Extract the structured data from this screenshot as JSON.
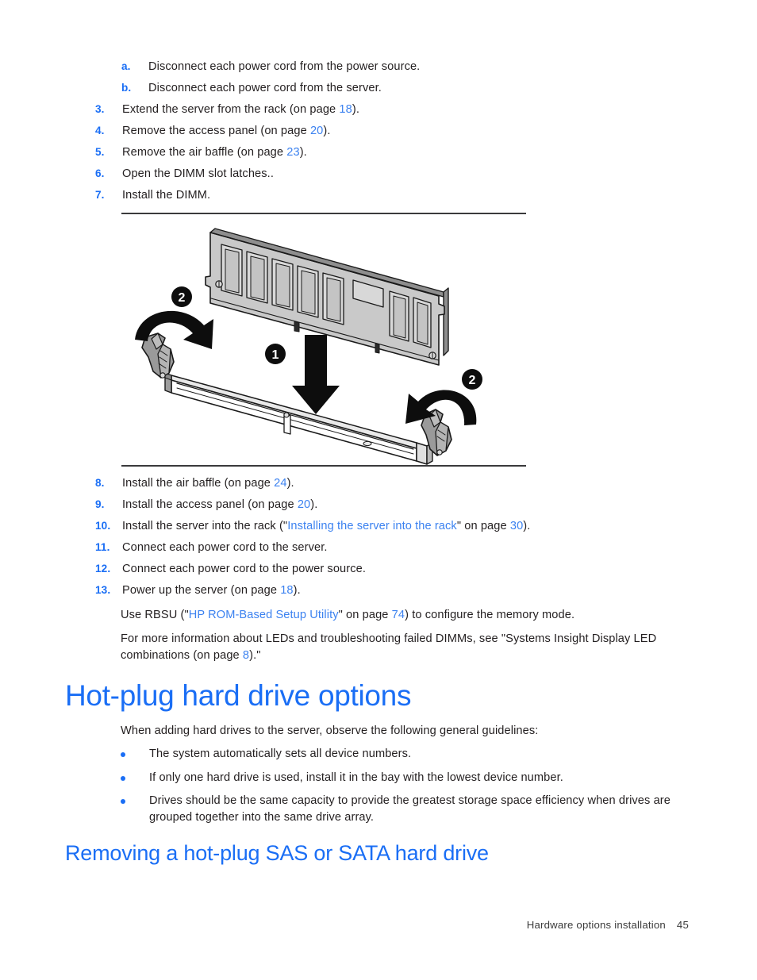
{
  "document": {
    "footer": {
      "chapter": "Hardware options installation",
      "page_number": "45"
    }
  },
  "steps_upper": [
    {
      "marker": "a.",
      "text_before": "Disconnect each power cord from the power source.",
      "text_after": ""
    },
    {
      "marker": "b.",
      "text_before": "Disconnect each power cord from the server.",
      "text_after": ""
    },
    {
      "marker": "3.",
      "text_before": "Extend the server from the rack (on page ",
      "page": "18",
      "text_after": ")."
    },
    {
      "marker": "4.",
      "text_before": "Remove the access panel (on page ",
      "page": "20",
      "text_after": ")."
    },
    {
      "marker": "5.",
      "text_before": "Remove the air baffle (on page ",
      "page": "23",
      "text_after": ")."
    },
    {
      "marker": "6.",
      "text_before": "Open the DIMM slot latches..",
      "text_after": ""
    },
    {
      "marker": "7.",
      "text_before": "Install the DIMM.",
      "text_after": ""
    }
  ],
  "figure": {
    "caption": "",
    "callouts": [
      {
        "id": "1",
        "label": "1",
        "meaning": "insert-dimm-downward"
      },
      {
        "id": "2a",
        "label": "2",
        "meaning": "close-left-latch"
      },
      {
        "id": "2b",
        "label": "2",
        "meaning": "close-right-latch"
      }
    ],
    "alt": "DIMM module being pressed down into a memory slot while both slot latches rotate closed"
  },
  "steps_lower": [
    {
      "marker": "8.",
      "text_before": "Install the air baffle (on page ",
      "page": "24",
      "text_after": ")."
    },
    {
      "marker": "9.",
      "text_before": "Install the access panel (on page ",
      "page": "20",
      "text_after": ")."
    },
    {
      "marker": "10.",
      "text_before": "Install the server into the rack (\"",
      "link": "Installing the server into the rack",
      "text_mid": "\" on page ",
      "page": "30",
      "text_after": ")."
    },
    {
      "marker": "11.",
      "text_before": "Connect each power cord to the server.",
      "text_after": ""
    },
    {
      "marker": "12.",
      "text_before": "Connect each power cord to the power source.",
      "text_after": ""
    },
    {
      "marker": "13.",
      "text_before": "Power up the server (on page ",
      "page": "18",
      "text_after": ")."
    }
  ],
  "paragraphs": {
    "rbsu_before": "Use RBSU (\"",
    "rbsu_link": "HP ROM-Based Setup Utility",
    "rbsu_mid": "\" on page ",
    "rbsu_page": "74",
    "rbsu_after": ") to configure the memory mode.",
    "leds_before": "For more information about LEDs and troubleshooting failed DIMMs, see \"Systems Insight Display LED combinations (on page ",
    "leds_page": "8",
    "leds_after": ")."
  },
  "section_hotplug": {
    "heading": "Hot-plug hard drive options",
    "intro": "When adding hard drives to the server, observe the following general guidelines:",
    "bullets": [
      "The system automatically sets all device numbers.",
      "If only one hard drive is used, install it in the bay with the lowest device number.",
      "Drives should be the same capacity to provide the greatest storage space efficiency when drives are grouped together into the same drive array."
    ]
  },
  "section_removing": {
    "heading": "Removing a hot-plug SAS or SATA hard drive"
  },
  "colors": {
    "accent_blue": "#1a6ef5",
    "link_blue": "#3c82f0",
    "body_text": "#231f20",
    "figure_fill": "#c9c9c9",
    "figure_line": "#1a1a1a"
  }
}
